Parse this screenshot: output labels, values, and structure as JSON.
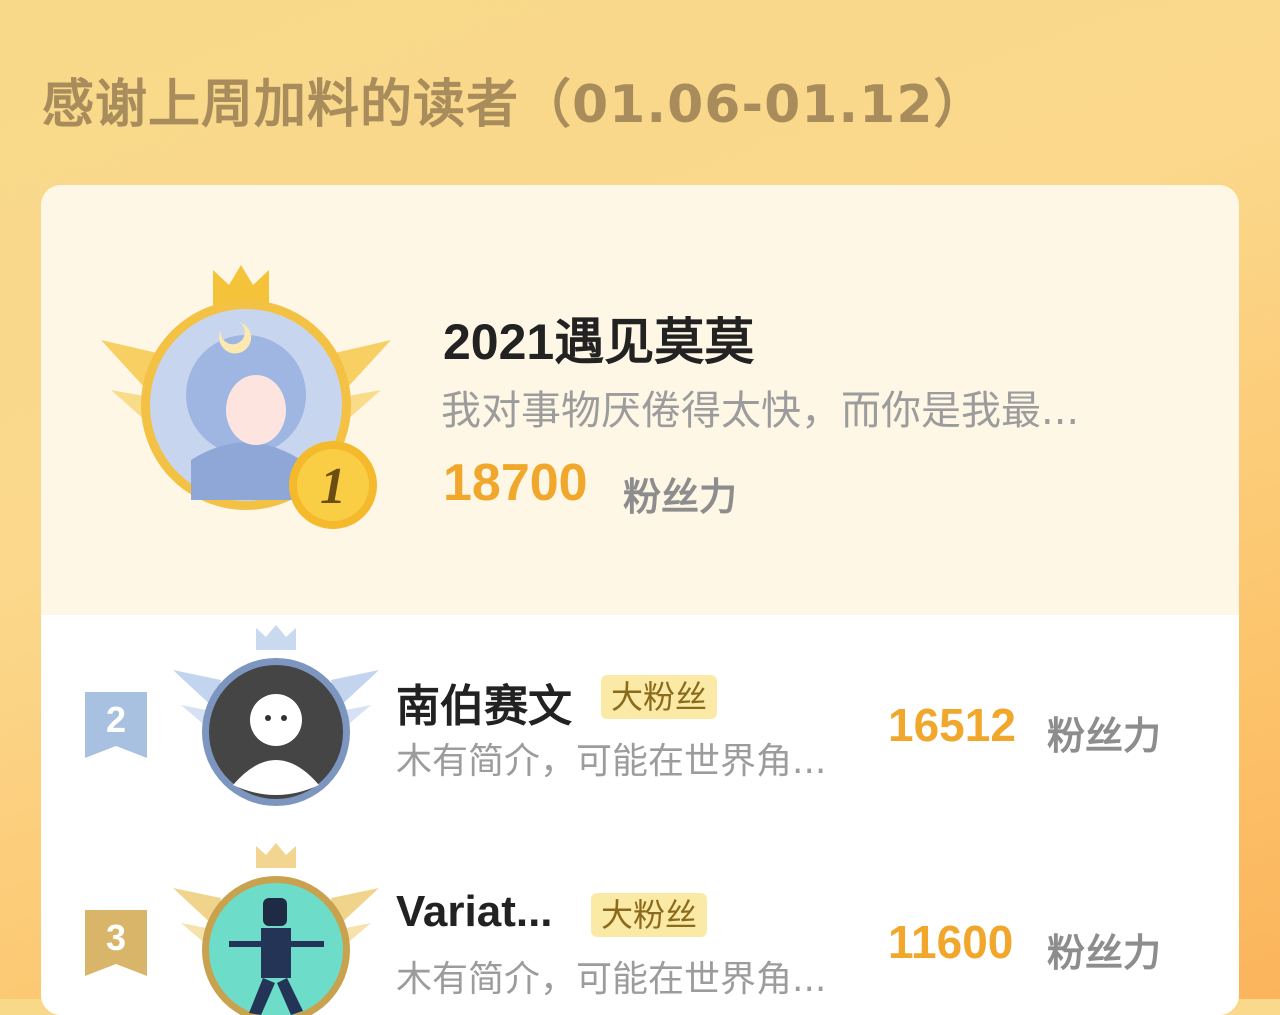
{
  "title": "感谢上周加料的读者（01.06-01.12）",
  "first": {
    "rank": "1",
    "name": "2021遇见莫莫",
    "bio": "我对事物厌倦得太快，而你是我最...",
    "score": "18700",
    "unit": "粉丝力"
  },
  "ranks": [
    {
      "rank": "2",
      "name": "南伯赛文",
      "badge": "大粉丝",
      "bio": "木有简介，可能在世界角...",
      "score": "16512",
      "unit": "粉丝力"
    },
    {
      "rank": "3",
      "name": "Variat...",
      "badge": "大粉丝",
      "bio": "木有简介，可能在世界角...",
      "score": "11600",
      "unit": "粉丝力"
    }
  ],
  "colors": {
    "score": "#f0a72b",
    "gold": "#f5c33a",
    "silver": "#a9c1e0",
    "bronze": "#d9b56a"
  }
}
